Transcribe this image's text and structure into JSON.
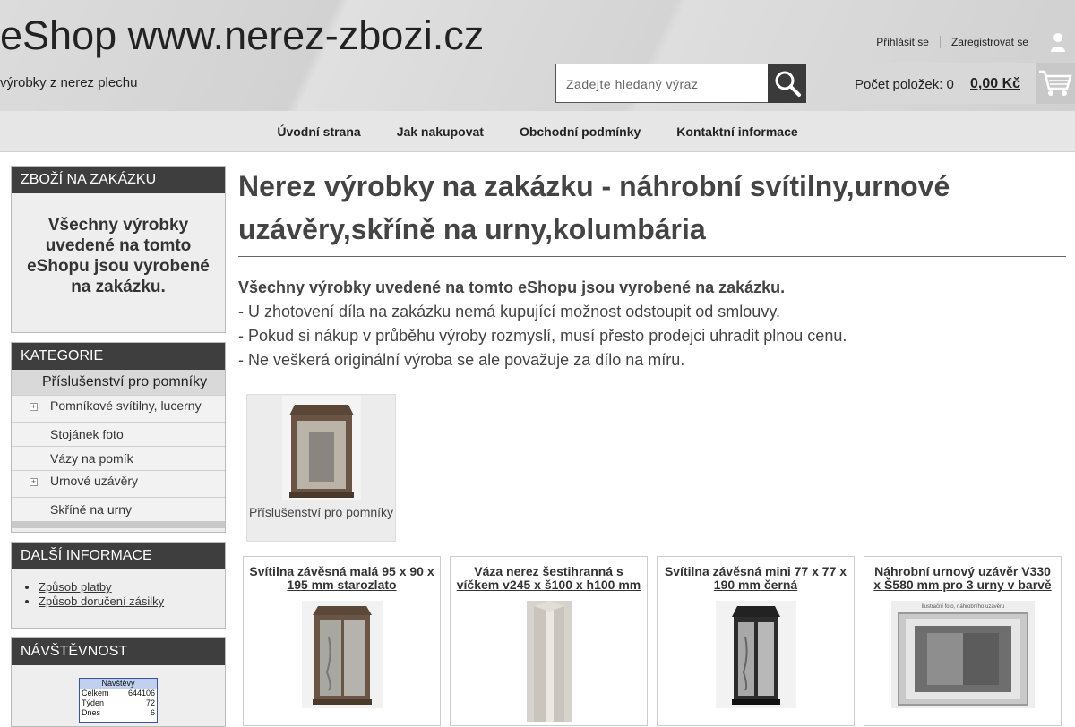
{
  "header": {
    "site_title": "eShop www.nerez-zbozi.cz",
    "tagline": "výrobky z nerez plechu",
    "login": "Přihlásit se",
    "register": "Zaregistrovat se",
    "search_placeholder": "Zadejte hledaný výraz",
    "cart_count": "Počet položek: 0",
    "cart_price": "0,00 Kč"
  },
  "nav": {
    "items": [
      "Úvodní strana",
      "Jak nakupovat",
      "Obchodní podmínky",
      "Kontaktní informace"
    ]
  },
  "sidebar": {
    "custom_box": {
      "title": "ZBOŽÍ NA ZAKÁZKU",
      "text": "Všechny výrobky uvedené na tomto eShopu jsou vyrobené na zakázku."
    },
    "categories": {
      "title": "KATEGORIE",
      "main": "Příslušenství pro pomníky",
      "items": [
        "Pomníkové svítilny, lucerny",
        "Stojánek foto",
        "Vázy na pomík",
        "Urnové uzávěry",
        "Skříně na urny"
      ]
    },
    "info": {
      "title": "DALŠÍ INFORMACE",
      "items": [
        "Způsob platby",
        "Způsob doručení zásilky"
      ]
    },
    "visits": {
      "title": "NÁVŠTĚVNOST",
      "counter_title": "Návštěvy",
      "rows": [
        {
          "label": "Celkem",
          "value": "644106"
        },
        {
          "label": "Týden",
          "value": "72"
        },
        {
          "label": "Dnes",
          "value": "6"
        }
      ]
    }
  },
  "main": {
    "title": "Nerez výrobky na zakázku - náhrobní svítilny,urnové uzávěry,skříně na urny,kolumbária",
    "notice_bold": "Všechny výrobky uvedené na tomto eShopu jsou vyrobené na zakázku.",
    "notice_lines": [
      "- U zhotovení díla na zakázku nemá kupující možnost odstoupit od smlouvy.",
      "- Pokud si nákup v průběhu výroby rozmyslí, musí přesto prodejci uhradit plnou cenu.",
      "- Ne veškerá originální výroba se ale považuje za dílo na míru."
    ],
    "subcategory": "Příslušenství pro pomníky",
    "products": [
      {
        "name": "Svítilna závěsná malá 95 x 90 x 195 mm starozlato"
      },
      {
        "name": "Váza nerez šestihranná s víčkem v245 x š100 x h100 mm"
      },
      {
        "name": "Svítilna závěsná mini 77 x 77 x 190 mm černá"
      },
      {
        "name": "Náhrobní urnový uzávěr V330 x Š580 mm pro 3 urny v barvě ...",
        "image_caption": "Ilustrační foto, náhrobního uzávěru"
      }
    ]
  }
}
